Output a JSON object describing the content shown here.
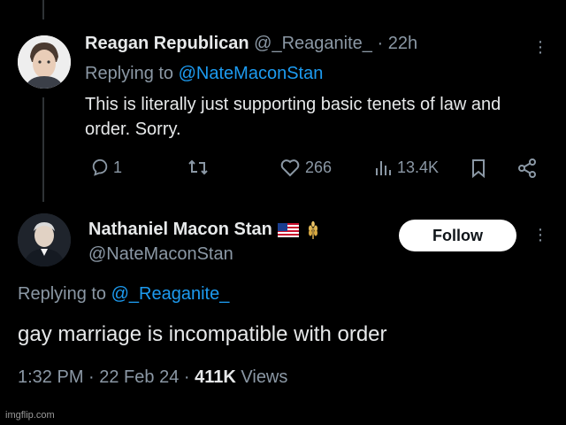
{
  "tweet1": {
    "author_name": "Reagan Republican",
    "handle": "@_Reaganite_",
    "separator": "·",
    "time": "22h",
    "replying_prefix": "Replying to",
    "replying_to": "@NateMaconStan",
    "body": "This is literally just supporting basic tenets of law and order. Sorry.",
    "replies": "1",
    "likes": "266",
    "views": "13.4K"
  },
  "tweet2": {
    "author_name": "Nathaniel Macon Stan",
    "handle": "@NateMaconStan",
    "follow_label": "Follow",
    "replying_prefix": "Replying to",
    "replying_to": "@_Reaganite_",
    "body": "gay marriage is incompatible with order",
    "timestamp": "1:32 PM · 22 Feb 24 ·",
    "views_count": "411K",
    "views_label": "Views"
  },
  "icons": {
    "reply": "reply-icon",
    "retweet": "retweet-icon",
    "like": "heart-icon",
    "views": "analytics-icon",
    "bookmark": "bookmark-icon",
    "share": "share-icon",
    "more": "more-icon",
    "flag": "us-flag-icon",
    "wheat": "wheat-icon"
  },
  "colors": {
    "background": "#000000",
    "text": "#e7e9ea",
    "secondary": "#8b98a5",
    "mention": "#1d9bf0",
    "follow_bg": "#ffffff"
  },
  "watermark": "imgflip.com"
}
